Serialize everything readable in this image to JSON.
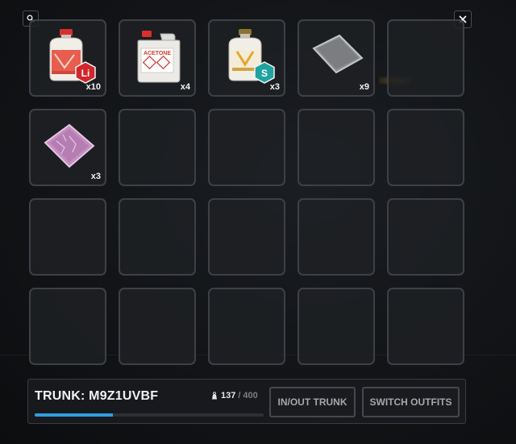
{
  "toolbar": {
    "search_icon": "search-icon",
    "close_icon": "close-icon"
  },
  "inventory": {
    "slots": [
      {
        "item": "lithium-jug",
        "badge": "Li",
        "badge_color": "#d2262c",
        "qty": "x10"
      },
      {
        "item": "acetone-canister",
        "label": "ACETONE",
        "qty": "x4"
      },
      {
        "item": "sulfuric-jug",
        "badge": "S",
        "badge_color": "#1fa3a0",
        "qty": "x3"
      },
      {
        "item": "metal-tray",
        "qty": "x9"
      },
      {
        "item": null
      },
      {
        "item": "pink-crystal-bag",
        "qty": "x3"
      },
      {
        "item": null
      },
      {
        "item": null
      },
      {
        "item": null
      },
      {
        "item": null
      },
      {
        "item": null
      },
      {
        "item": null
      },
      {
        "item": null
      },
      {
        "item": null
      },
      {
        "item": null
      },
      {
        "item": null
      },
      {
        "item": null
      },
      {
        "item": null
      },
      {
        "item": null
      },
      {
        "item": null
      }
    ]
  },
  "trunk": {
    "title": "TRUNK: M9Z1UVBF",
    "weight_icon": "weight-icon",
    "weight_current": "137",
    "weight_separator": "/",
    "weight_max": "400",
    "weight_fill_fraction": 0.3425,
    "bar_color": "#2f9fe0"
  },
  "actions": {
    "inout_label": "IN/OUT TRUNK",
    "switch_label": "SWITCH OUTFITS"
  }
}
